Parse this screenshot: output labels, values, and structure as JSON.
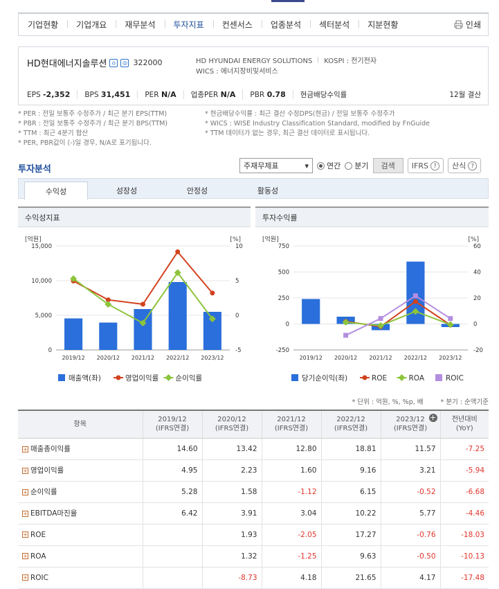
{
  "nav": {
    "items": [
      "기업현황",
      "기업개요",
      "재무분석",
      "투자지표",
      "컨센서스",
      "업종분석",
      "섹터분석",
      "지분현황"
    ],
    "active_index": 3,
    "print_label": "인쇄"
  },
  "company": {
    "name": "HD현대에너지솔루션",
    "code": "322000",
    "eng_name": "HD HYUNDAI ENERGY SOLUTIONS",
    "market": "KOSPI : 전기전자",
    "wics": "WICS : 에너지장비및서비스",
    "metrics": [
      {
        "label": "EPS",
        "value": "-2,352"
      },
      {
        "label": "BPS",
        "value": "31,451"
      },
      {
        "label": "PER",
        "value": "N/A"
      },
      {
        "label": "업종PER",
        "value": "N/A"
      },
      {
        "label": "PBR",
        "value": "0.78"
      },
      {
        "label": "현금배당수익률",
        "value": ""
      }
    ],
    "settlement": "12월 결산"
  },
  "notes": {
    "left": [
      "* PER : 전일 보통주 수정주가 / 최근 분기 EPS(TTM)",
      "* PBR : 전일 보통주 수정주가 / 최근 분기 BPS(TTM)",
      "* TTM : 최근 4분기 합산",
      "* PER, PBR값이 (-)일 경우, N/A로 표기됩니다."
    ],
    "right": [
      "* 현금배당수익률 : 최근 결산 수정DPS(현금) / 전일 보통주 수정주가",
      "* WICS : WISE Industry Classification Standard, modified by FnGuide",
      "* TTM 데이터가 없는 경우, 최근 결산 데이터로 표시됩니다."
    ]
  },
  "section": {
    "title": "투자분석",
    "select_value": "주재무제표",
    "radio_annual": "연간",
    "radio_quarter": "분기",
    "search_button": "검색",
    "ifrs_label": "IFRS",
    "calc_label": "산식"
  },
  "tabs": [
    "수익성",
    "성장성",
    "안정성",
    "활동성"
  ],
  "panels": {
    "left_title": "수익성지표",
    "right_title": "투자수익률"
  },
  "colors": {
    "bar": "#2a6fdb",
    "red": "#d2421e",
    "green": "#8cc43c",
    "purple": "#b48ee0"
  },
  "chart_data": [
    {
      "type": "bar",
      "title": "수익성지표",
      "categories": [
        "2019/12",
        "2020/12",
        "2021/12",
        "2022/12",
        "2023/12"
      ],
      "y_unit": "[억원]",
      "y2_unit": "[%]",
      "y_ticks": [
        "15,000",
        "10,000",
        "5,000",
        "0"
      ],
      "y2_ticks": [
        "10",
        "5",
        "0",
        "-5"
      ],
      "ylim": [
        0,
        15000
      ],
      "y2lim": [
        -5,
        10
      ],
      "series": [
        {
          "name": "매출액(좌)",
          "kind": "bar",
          "axis": "left",
          "values": [
            4550,
            3950,
            5900,
            9800,
            5500
          ]
        },
        {
          "name": "영업이익률",
          "kind": "line",
          "axis": "right",
          "values": [
            4.95,
            2.23,
            1.6,
            9.16,
            3.21
          ]
        },
        {
          "name": "순이익률",
          "kind": "line",
          "axis": "right",
          "values": [
            5.28,
            1.58,
            -1.12,
            6.15,
            -0.52
          ]
        }
      ]
    },
    {
      "type": "bar",
      "title": "투자수익률",
      "categories": [
        "2019/12",
        "2020/12",
        "2021/12",
        "2022/12",
        "2023/12"
      ],
      "y_unit": "[억원]",
      "y2_unit": "[%]",
      "y_ticks": [
        "750",
        "500",
        "250",
        "0",
        "-250"
      ],
      "y2_ticks": [
        "60",
        "40",
        "20",
        "0",
        "-20"
      ],
      "ylim": [
        -250,
        750
      ],
      "y2lim": [
        -20,
        60
      ],
      "series": [
        {
          "name": "당기순이익(좌)",
          "kind": "bar",
          "axis": "left",
          "values": [
            240,
            70,
            -60,
            600,
            -30
          ]
        },
        {
          "name": "ROE",
          "kind": "line",
          "axis": "right",
          "values": [
            null,
            1.93,
            -2.05,
            17.27,
            -0.76
          ]
        },
        {
          "name": "ROA",
          "kind": "line",
          "axis": "right",
          "values": [
            null,
            1.32,
            -1.25,
            9.63,
            -0.5
          ]
        },
        {
          "name": "ROIC",
          "kind": "line",
          "axis": "right",
          "values": [
            null,
            -8.73,
            4.18,
            21.65,
            4.17
          ]
        }
      ]
    }
  ],
  "unit_note": "* 단위 : 억원, %, %p, 배",
  "quarter_note": "* 분기 : 순액기준",
  "table": {
    "item_header": "항목",
    "columns": [
      {
        "year": "2019/12",
        "basis": "(IFRS연결)"
      },
      {
        "year": "2020/12",
        "basis": "(IFRS연결)"
      },
      {
        "year": "2021/12",
        "basis": "(IFRS연결)"
      },
      {
        "year": "2022/12",
        "basis": "(IFRS연결)"
      },
      {
        "year": "2023/12",
        "basis": "(IFRS연결)"
      }
    ],
    "yoy_header": {
      "top": "전년대비",
      "bottom": "(YoY)"
    },
    "rows": [
      {
        "label": "매출총이익률",
        "values": [
          "14.60",
          "13.42",
          "12.80",
          "18.81",
          "11.57"
        ],
        "yoy": "-7.25"
      },
      {
        "label": "영업이익률",
        "values": [
          "4.95",
          "2.23",
          "1.60",
          "9.16",
          "3.21"
        ],
        "yoy": "-5.94"
      },
      {
        "label": "순이익률",
        "values": [
          "5.28",
          "1.58",
          "-1.12",
          "6.15",
          "-0.52"
        ],
        "yoy": "-6.68"
      },
      {
        "label": "EBITDA마진율",
        "values": [
          "6.42",
          "3.91",
          "3.04",
          "10.22",
          "5.77"
        ],
        "yoy": "-4.46"
      },
      {
        "label": "ROE",
        "values": [
          "",
          "1.93",
          "-2.05",
          "17.27",
          "-0.76"
        ],
        "yoy": "-18.03"
      },
      {
        "label": "ROA",
        "values": [
          "",
          "1.32",
          "-1.25",
          "9.63",
          "-0.50"
        ],
        "yoy": "-10.13"
      },
      {
        "label": "ROIC",
        "values": [
          "",
          "-8.73",
          "4.18",
          "21.65",
          "4.17"
        ],
        "yoy": "-17.48"
      }
    ]
  }
}
